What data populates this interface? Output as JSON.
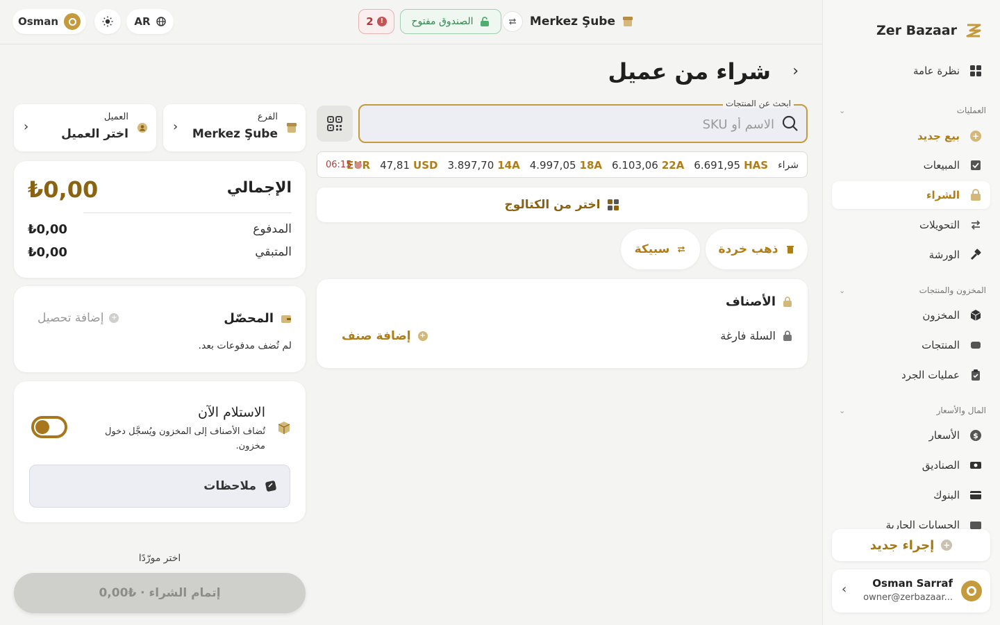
{
  "app": {
    "brand": "Zer Bazaar"
  },
  "colors": {
    "accent": "#c49a3c",
    "gold_text": "#b07d16",
    "success": "#2f8a4d",
    "danger": "#b33b3b"
  },
  "topbar": {
    "user_name": "Osman",
    "language": "AR",
    "branch": "Merkez Şube",
    "cash_status": "الصندوق مفتوح",
    "alert_count": "2"
  },
  "page": {
    "title": "شراء من عميل"
  },
  "search": {
    "legend": "ابحث عن المنتجات",
    "placeholder": "الاسم أو SKU"
  },
  "rates": {
    "label": "شراء",
    "items": [
      {
        "code": "HAS",
        "value": "6.691,95"
      },
      {
        "code": "22A",
        "value": "6.103,06"
      },
      {
        "code": "18A",
        "value": "4.997,05"
      },
      {
        "code": "14A",
        "value": "3.897,70"
      },
      {
        "code": "USD",
        "value": "47,81"
      },
      {
        "code": "EUR",
        "value": ""
      }
    ],
    "time": "06:15"
  },
  "actions": {
    "catalog": "اختر من الكتالوج",
    "scrap_gold": "ذهب خردة",
    "bullion": "سبيكة"
  },
  "items": {
    "title": "الأصناف",
    "empty": "السلة فارغة",
    "add": "إضافة صنف"
  },
  "selectors": {
    "branch_label": "الفرع",
    "branch_value": "Merkez Şube",
    "customer_label": "العميل",
    "customer_value": "اختر العميل"
  },
  "totals": {
    "total_label": "الإجمالي",
    "total_value": "₺0,00",
    "paid_label": "المدفوع",
    "paid_value": "₺0,00",
    "remaining_label": "المتبقي",
    "remaining_value": "₺0,00"
  },
  "collector": {
    "title": "المحصّل",
    "add": "إضافة تحصيل",
    "empty": "لم تُضف مدفوعات بعد."
  },
  "receive": {
    "title": "الاستلام الآن",
    "desc": "تُضاف الأصناف إلى المخزون ويُسجَّل دخول مخزون.",
    "toggle_on": false,
    "notes": "ملاحظات"
  },
  "footer": {
    "pick_supplier": "اختر مورّدًا",
    "complete": "إتمام الشراء · ₺0,00"
  },
  "sidebar": {
    "overview": "نظرة عامة",
    "sections": [
      {
        "title": "العمليات",
        "items": [
          "بيع جديد",
          "المبيعات",
          "الشراء",
          "التحويلات",
          "الورشة"
        ]
      },
      {
        "title": "المخزون والمنتجات",
        "items": [
          "المخزون",
          "المنتجات",
          "عمليات الجرد"
        ]
      },
      {
        "title": "المال والأسعار",
        "items": [
          "الأسعار",
          "الصناديق",
          "البنوك",
          "الحسابات الجارية"
        ]
      }
    ],
    "new_action": "إجراء جديد",
    "user": {
      "name": "Osman Sarraf",
      "email": "owner@zerbazaar..."
    }
  }
}
